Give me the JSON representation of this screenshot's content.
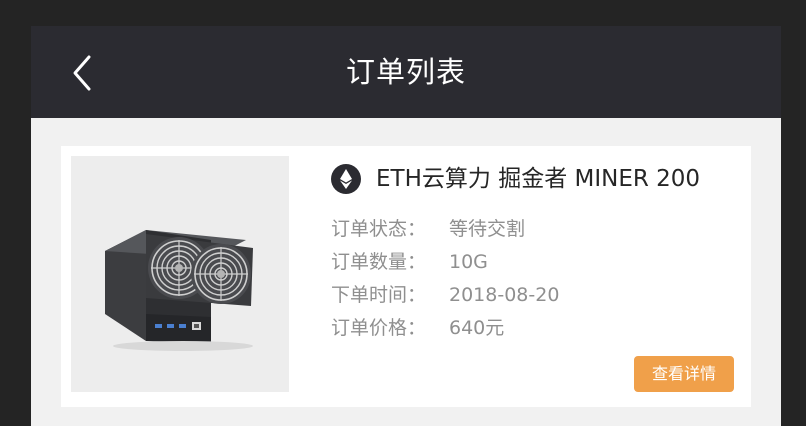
{
  "nav": {
    "title": "订单列表",
    "back_icon": "chevron-left-icon"
  },
  "order": {
    "coin_icon": "ethereum-icon",
    "product_title": "ETH云算力 掘金者 MINER 200",
    "fields": [
      {
        "label": "订单状态：",
        "value": "等待交割"
      },
      {
        "label": "订单数量：",
        "value": "10G"
      },
      {
        "label": "下单时间：",
        "value": "2018-08-20"
      },
      {
        "label": "订单价格：",
        "value": "640元"
      }
    ],
    "detail_button": "查看详情"
  },
  "colors": {
    "nav_bg": "#2b2b31",
    "page_bg": "#f1f1f1",
    "accent": "#f0a04a",
    "label": "#8f8f8f",
    "title": "#262626"
  }
}
